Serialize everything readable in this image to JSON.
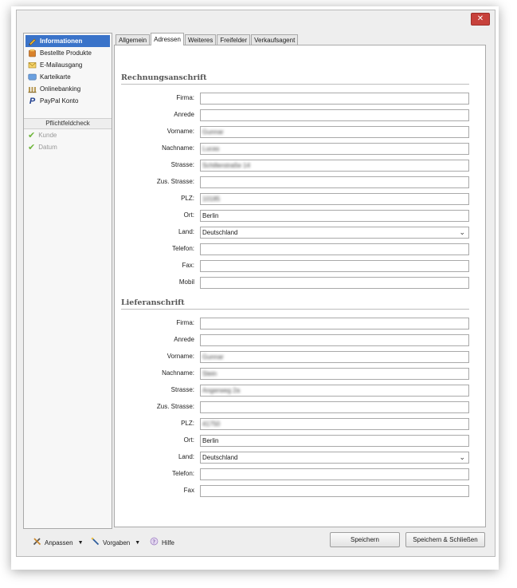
{
  "window": {
    "close_label": "✕"
  },
  "sidebar": {
    "items": [
      {
        "label": "Informationen",
        "icon": "pencil-icon"
      },
      {
        "label": "Bestellte Produkte",
        "icon": "box-icon"
      },
      {
        "label": "E-Mailausgang",
        "icon": "mail-icon"
      },
      {
        "label": "Karteikarte",
        "icon": "card-icon"
      },
      {
        "label": "Onlinebanking",
        "icon": "bank-icon"
      },
      {
        "label": "PayPal Konto",
        "icon": "paypal-icon"
      }
    ],
    "check_title": "Pflichtfeldcheck",
    "checks": [
      {
        "label": "Kunde"
      },
      {
        "label": "Datum"
      }
    ]
  },
  "tabs": [
    {
      "label": "Allgemein"
    },
    {
      "label": "Adressen"
    },
    {
      "label": "Weiteres"
    },
    {
      "label": "Freifelder"
    },
    {
      "label": "Verkaufsagent"
    }
  ],
  "billing": {
    "title": "Rechnungsanschrift",
    "fields": [
      {
        "label": "Firma:",
        "value": ""
      },
      {
        "label": "Anrede",
        "value": ""
      },
      {
        "label": "Vorname:",
        "value": "Gunnar"
      },
      {
        "label": "Nachname:",
        "value": "Lucas"
      },
      {
        "label": "Strasse:",
        "value": "Schillerstraße 14"
      },
      {
        "label": "Zus. Strasse:",
        "value": ""
      },
      {
        "label": "PLZ:",
        "value": "10185"
      },
      {
        "label": "Ort:",
        "value": "Berlin"
      },
      {
        "label": "Land:",
        "value": "Deutschland"
      },
      {
        "label": "Telefon:",
        "value": ""
      },
      {
        "label": "Fax:",
        "value": ""
      },
      {
        "label": "Mobil",
        "value": ""
      }
    ]
  },
  "shipping": {
    "title": "Lieferanschrift",
    "fields": [
      {
        "label": "Firma:",
        "value": ""
      },
      {
        "label": "Anrede",
        "value": ""
      },
      {
        "label": "Vorname:",
        "value": "Gunnar"
      },
      {
        "label": "Nachname:",
        "value": "Stein"
      },
      {
        "label": "Strasse:",
        "value": "Angerweg 2a"
      },
      {
        "label": "Zus. Strasse:",
        "value": ""
      },
      {
        "label": "PLZ:",
        "value": "41750"
      },
      {
        "label": "Ort:",
        "value": "Berlin"
      },
      {
        "label": "Land:",
        "value": "Deutschland"
      },
      {
        "label": "Telefon:",
        "value": ""
      },
      {
        "label": "Fax",
        "value": ""
      }
    ]
  },
  "toolbar": {
    "anpassen": "Anpassen",
    "vorgaben": "Vorgaben",
    "hilfe": "Hilfe",
    "save": "Speichern",
    "save_close": "Speichern & Schließen"
  },
  "colors": {
    "accent": "#3a73c9",
    "close": "#c7413b",
    "check": "#6fb63c"
  }
}
